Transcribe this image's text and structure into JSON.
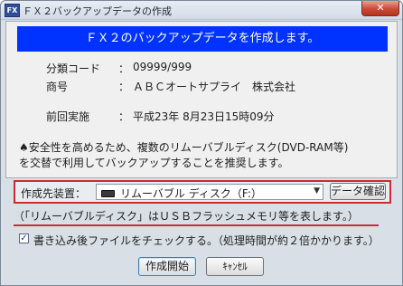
{
  "window": {
    "app_icon": "FX",
    "title": "ＦＸ２バックアップデータの作成",
    "close_label": "✕"
  },
  "banner": "ＦＸ２のバックアップデータを作成します。",
  "info": [
    {
      "label": "分類コード",
      "colon": "：",
      "value": "09999/999"
    },
    {
      "label": "商号",
      "colon": "：",
      "value": "ＡＢＣオートサプライ　株式会社"
    },
    {
      "label": "前回実施",
      "colon": "：",
      "value": "平成23年  8月23日15時09分"
    }
  ],
  "notice": {
    "line1": "♠安全性を高めるため、複数のリムーバブルディスク(DVD-RAM等)",
    "line2": "を交替で利用してバックアップすることを推奨します。"
  },
  "device": {
    "label": "作成先装置：",
    "icon": "drive-icon",
    "selected": "リムーバブル  ディスク（F:）",
    "check_button": "データ確認"
  },
  "usb_note": "（「リムーバブルディスク」はＵＳＢフラッシュメモリ等を表します。）",
  "file_check": {
    "checked": true,
    "label": "書き込み後ファイルをチェックする。（処理時間が約２倍かかります。）"
  },
  "buttons": {
    "start": "作成開始",
    "cancel": "ｷｬﾝｾﾙ"
  },
  "colors": {
    "banner_bg": "#0033ff",
    "highlight_red": "#d12b2b"
  }
}
